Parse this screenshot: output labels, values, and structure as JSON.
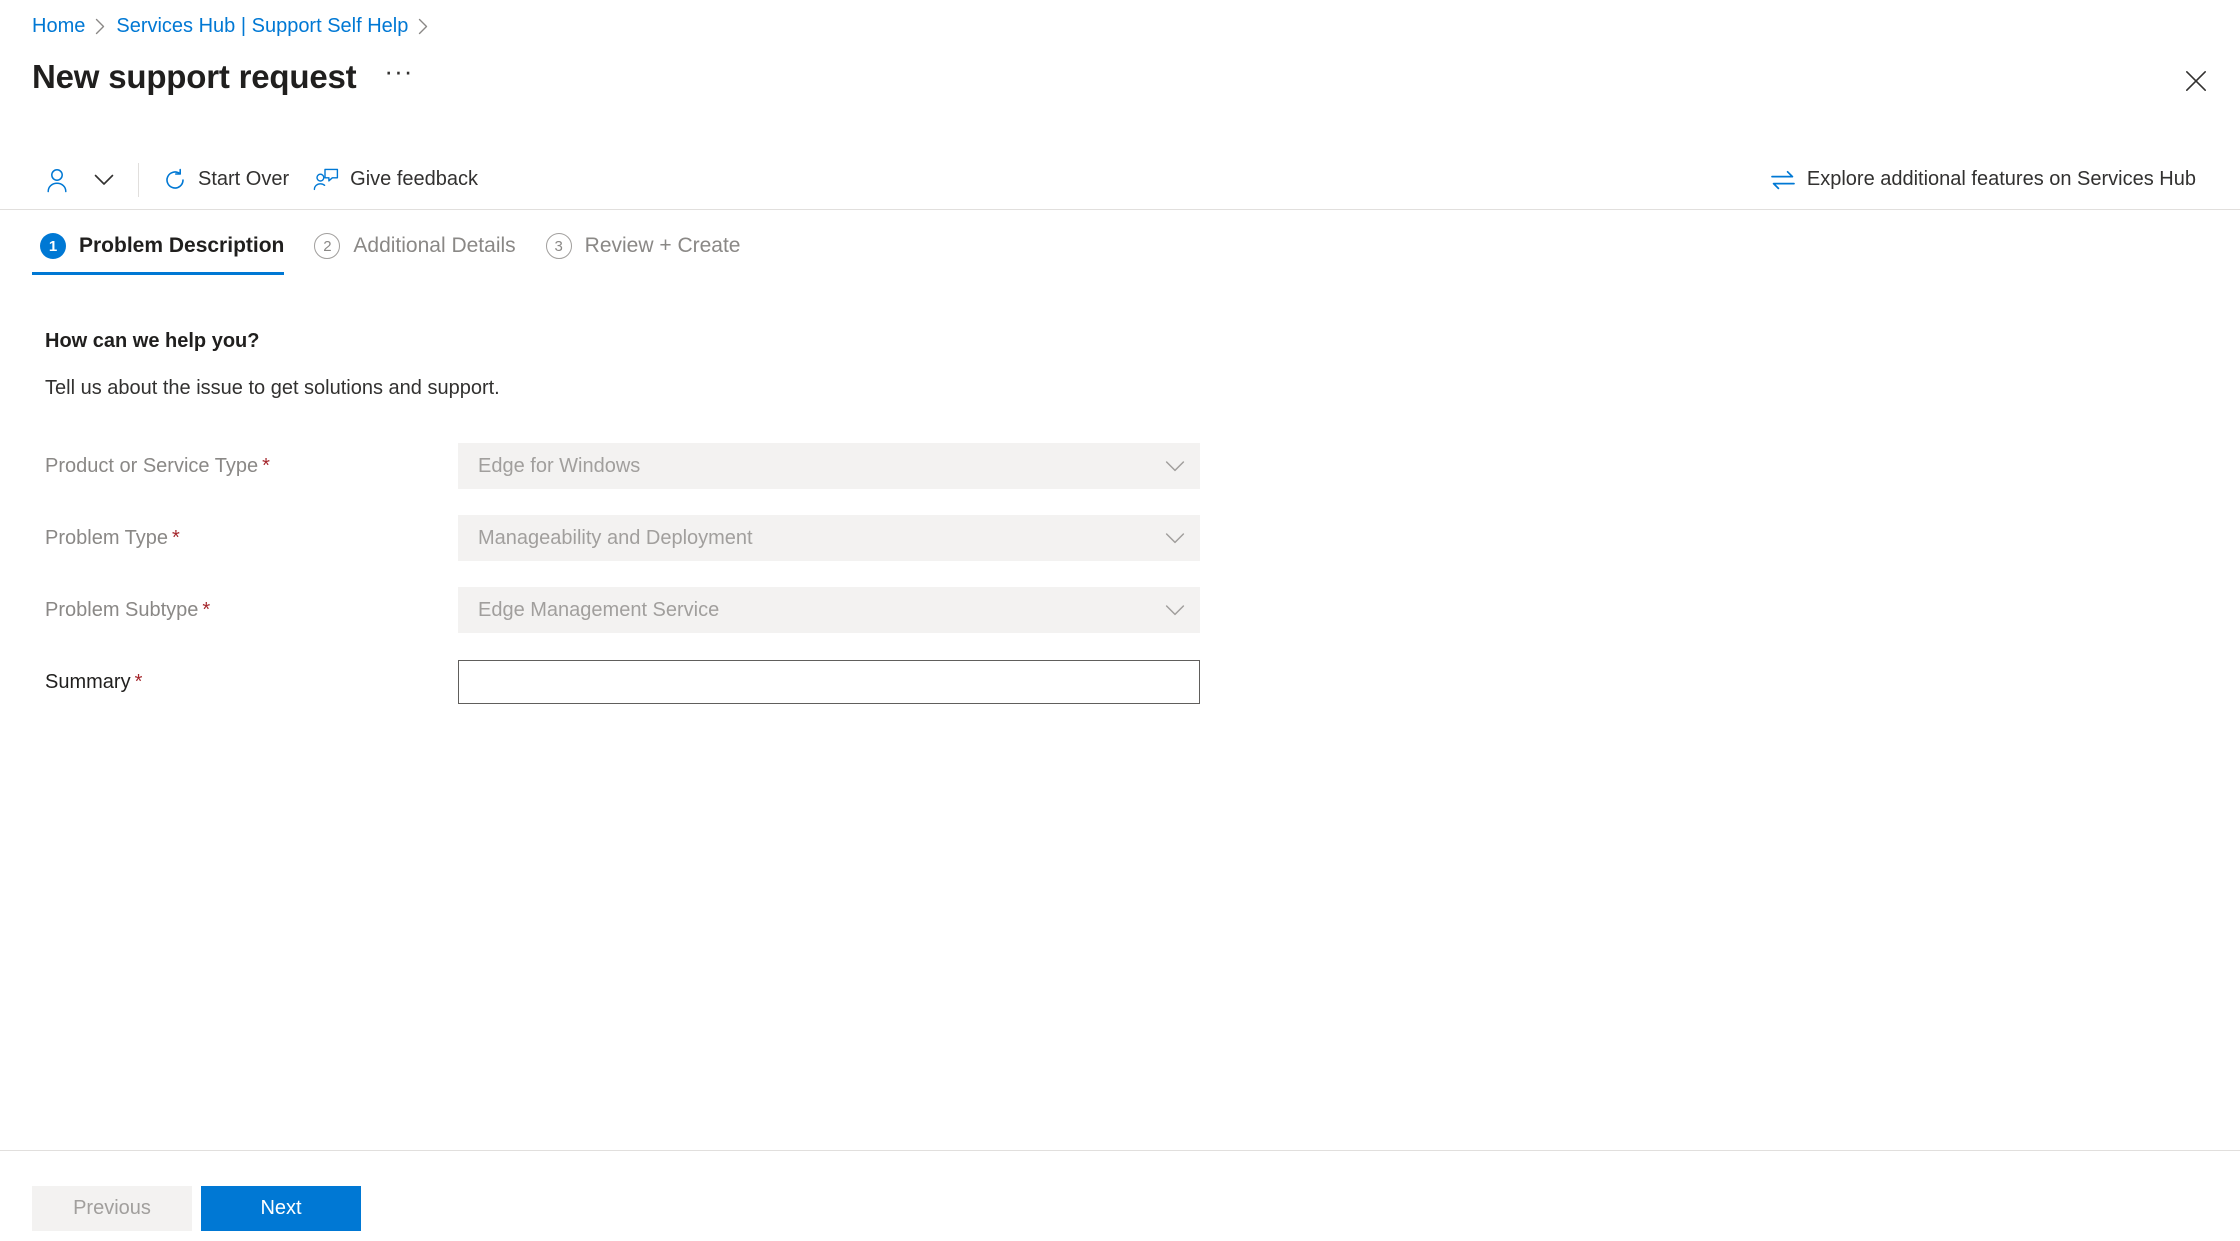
{
  "breadcrumb": {
    "items": [
      {
        "label": "Home"
      },
      {
        "label": "Services Hub | Support Self Help"
      }
    ]
  },
  "header": {
    "title": "New support request",
    "ellipsis": "···",
    "close_icon": "close-icon"
  },
  "commandbar": {
    "contact_icon": "contact-person-icon",
    "chevron_icon": "chevron-down-icon",
    "start_over": {
      "label": "Start Over",
      "icon": "refresh-icon"
    },
    "give_feedback": {
      "label": "Give feedback",
      "icon": "feedback-person-icon"
    },
    "explore": {
      "label": "Explore additional features on Services Hub",
      "icon": "swap-arrows-icon"
    }
  },
  "tabs": [
    {
      "number": "1",
      "label": "Problem Description",
      "state": "active"
    },
    {
      "number": "2",
      "label": "Additional Details",
      "state": "inactive"
    },
    {
      "number": "3",
      "label": "Review + Create",
      "state": "inactive"
    }
  ],
  "section": {
    "heading": "How can we help you?",
    "subtext": "Tell us about the issue to get solutions and support."
  },
  "fields": [
    {
      "label": "Product or Service Type",
      "required": "*",
      "type": "dropdown",
      "value": "Edge for Windows",
      "disabled": true
    },
    {
      "label": "Problem Type",
      "required": "*",
      "type": "dropdown",
      "value": "Manageability and Deployment",
      "disabled": true
    },
    {
      "label": "Problem Subtype",
      "required": "*",
      "type": "dropdown",
      "value": "Edge Management Service",
      "disabled": true
    },
    {
      "label": "Summary",
      "required": "*",
      "type": "text",
      "value": "",
      "placeholder": "",
      "disabled": false
    }
  ],
  "footer": {
    "previous": "Previous",
    "next": "Next"
  },
  "colors": {
    "accent": "#0078d4",
    "link": "#0078d4",
    "required": "#a4262c",
    "disabled_text": "#a19f9d",
    "disabled_fill": "#f3f2f1",
    "divider": "#e1dfdd",
    "text": "#201f1e"
  }
}
